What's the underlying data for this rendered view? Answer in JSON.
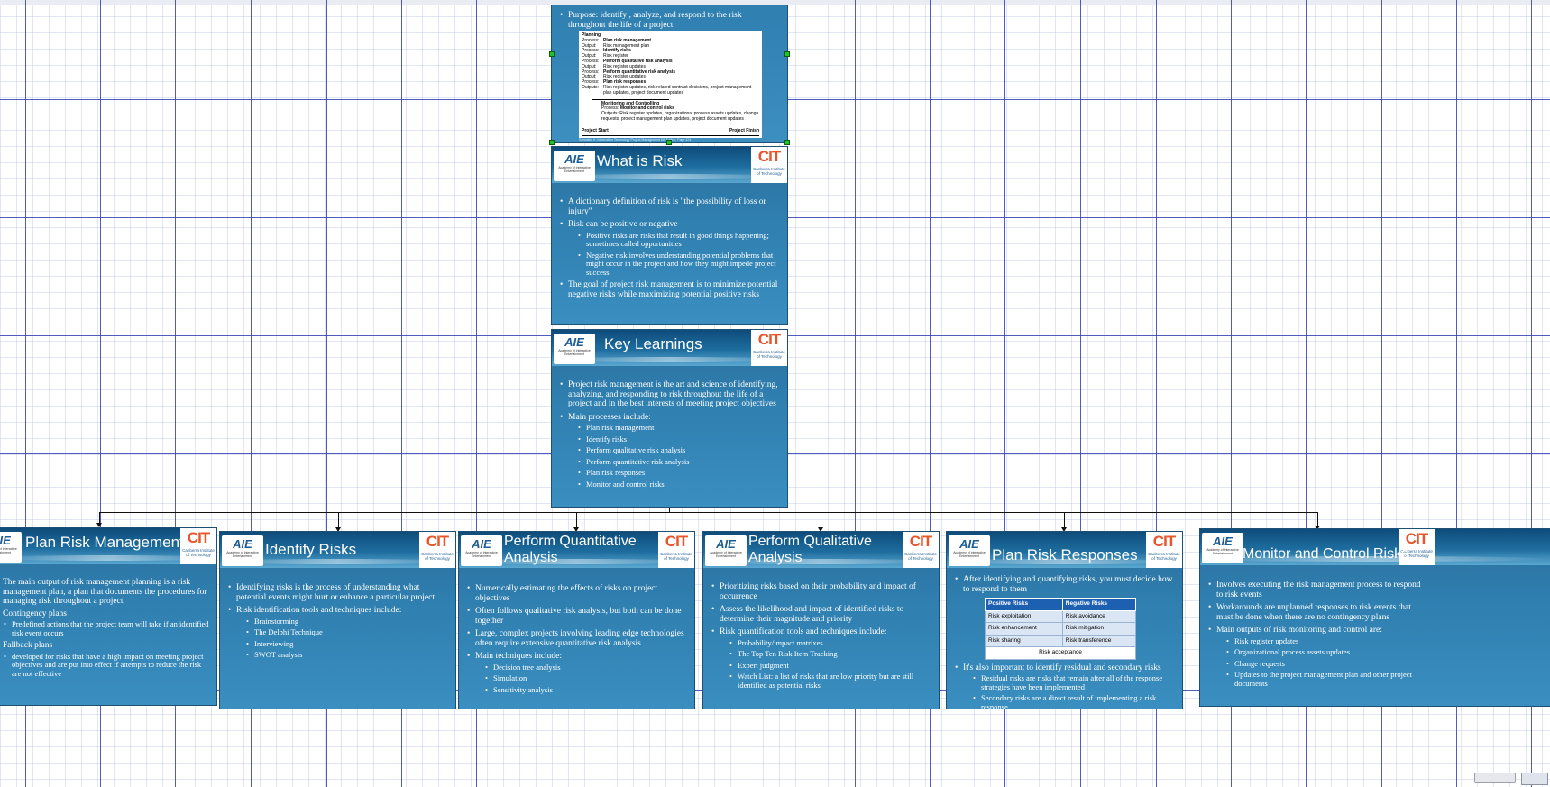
{
  "colors": {
    "canvas_bg": "#ffffff",
    "guide_line": "#3340b0",
    "slide_bg": "#2f7fb0",
    "handle": "#22c12a",
    "accent_orange": "#e8552a",
    "table_header": "#1d5fb0"
  },
  "logos": {
    "aie": "AIE",
    "aie_sub": "Academy of Interactive Entertainment",
    "cit": "CIT",
    "cit_sub": "Canberra Institute of Technology"
  },
  "top_slide": {
    "bullet": "Purpose: identify , analyze, and respond to the risk throughout the life of a project",
    "card": {
      "planning": "Planning",
      "rows": [
        {
          "k": "Process:",
          "v": "Plan risk management",
          "bold": true
        },
        {
          "k": "Output:",
          "v": "Risk management plan",
          "bold": false
        },
        {
          "k": "Process:",
          "v": "Identify risks",
          "bold": true
        },
        {
          "k": "Output:",
          "v": "Risk register",
          "bold": false
        },
        {
          "k": "Process:",
          "v": "Perform qualitative risk analysis",
          "bold": true
        },
        {
          "k": "Output:",
          "v": "Risk register updates",
          "bold": false
        },
        {
          "k": "Process:",
          "v": "Perform quantitative risk analysis",
          "bold": true
        },
        {
          "k": "Output:",
          "v": "Risk register updates",
          "bold": false
        },
        {
          "k": "Process:",
          "v": "Plan risk responses",
          "bold": true
        },
        {
          "k": "Outputs:",
          "v": "Risk register updates, risk-related contract decisions, project management plan updates, project document updates",
          "bold": false
        }
      ],
      "monitoring": "Monitoring and Controlling",
      "mc_process_k": "Process:",
      "mc_process_v": "Monitor and control risks",
      "mc_outputs_k": "Outputs:",
      "mc_outputs_v": "Risk register updates, organizational process assets updates, change requests, project management plan updates, project document updates",
      "start": "Project Start",
      "finish": "Project Finish"
    },
    "footer": "Schwalbe K. Information Technology Project Management 6th Edition, Page 424"
  },
  "what_is_risk": {
    "title": "What is Risk",
    "b1": "A dictionary definition of risk is \"the possibility of loss or injury\"",
    "b2": "Risk can be positive or negative",
    "b2s1": "Positive risks are risks that result in good things happening; sometimes called opportunities",
    "b2s2": "Negative risk involves understanding potential problems that might occur in the project and how they might impede project success",
    "b3": "The goal of project risk management is to minimize potential negative risks while maximizing potential positive risks"
  },
  "key_learnings": {
    "title": "Key Learnings",
    "b1": "Project risk management is the art and science of identifying, analyzing, and responding to risk throughout the life of a project and in the best interests of meeting project objectives",
    "b2": "Main processes include:",
    "subs": [
      "Plan risk management",
      "Identify risks",
      "Perform qualitative risk analysis",
      "Perform quantitative risk analysis",
      "Plan risk responses",
      "Monitor and control risks"
    ]
  },
  "plan_risk_mgmt": {
    "title": "Plan Risk Management",
    "p1": "The main output of risk management planning is a risk management plan, a plan that documents the procedures for managing risk throughout a project",
    "h1": "Contingency plans",
    "s1": "Predefined actions that the project team will take if an identified risk event occurs",
    "h2": "Fallback plans",
    "s2": "developed for risks that have a high impact on meeting project objectives and are put into effect if attempts to reduce the risk are not effective"
  },
  "identify_risks": {
    "title": "Identify Risks",
    "b1": "Identifying risks is the process of understanding what potential events might hurt or enhance a particular project",
    "b2": "Risk identification tools and techniques include:",
    "subs": [
      "Brainstorming",
      "The Delphi Technique",
      "Interviewing",
      "SWOT analysis"
    ]
  },
  "quant": {
    "title": "Perform Quantitative Analysis",
    "b1": "Numerically estimating the effects of risks on project objectives",
    "b2": "Often follows qualitative risk analysis, but both can be done together",
    "b3": "Large, complex projects involving leading edge technologies often require extensive quantitative risk analysis",
    "b4": "Main techniques include:",
    "subs": [
      "Decision tree analysis",
      "Simulation",
      "Sensitivity analysis"
    ]
  },
  "qual": {
    "title": "Perform Qualitative Analysis",
    "b1": "Prioritizing risks based on their probability and impact of occurrence",
    "b2": "Assess the likelihood and impact of identified risks to determine their magnitude and priority",
    "b3": "Risk quantification tools and techniques include:",
    "subs": [
      "Probability/impact matrixes",
      "The Top Ten Risk Item Tracking",
      "Expert judgment",
      "Watch List: a list of risks that are low priority but are still identified as potential risks"
    ]
  },
  "responses": {
    "title": "Plan Risk Responses",
    "b1": "After identifying and quantifying risks, you must decide how to respond to them",
    "table": {
      "h_pos": "Positive Risks",
      "h_neg": "Negative Risks",
      "rows": [
        [
          "Risk exploitation",
          "Risk avoidance"
        ],
        [
          "Risk enhancement",
          "Risk mitigation"
        ],
        [
          "Risk sharing",
          "Risk transference"
        ]
      ],
      "acceptance": "Risk acceptance"
    },
    "b2": "It's also important to identify residual and secondary risks",
    "subs": [
      "Residual risks are risks that remain after all of the response strategies have been implemented",
      "Secondary risks are a direct result of implementing a risk response"
    ]
  },
  "monitor": {
    "title": "Monitor and Control Risks",
    "b1": "Involves executing the risk management process to respond to risk events",
    "b2": "Workarounds are unplanned responses to risk events that must be done when there are no contingency plans",
    "b3": "Main outputs of risk monitoring and control are:",
    "subs": [
      "Risk register updates",
      "Organizational process assets updates",
      "Change requests",
      "Updates to the project management plan and other project documents"
    ]
  }
}
